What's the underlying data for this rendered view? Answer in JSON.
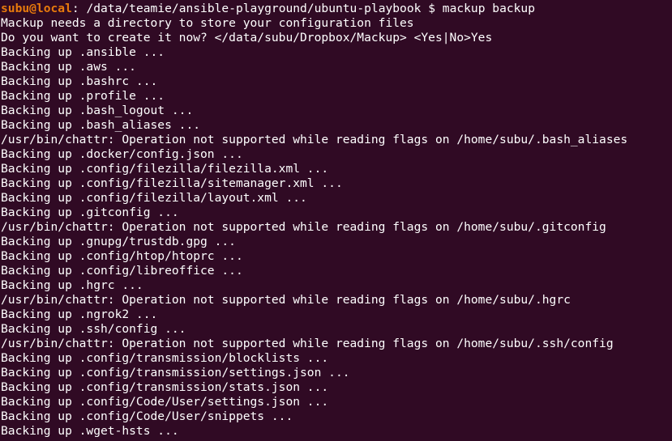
{
  "prompt": {
    "user": "subu",
    "at": "@",
    "host": "local",
    "separator": ": ",
    "path": "/data/teamie/ansible-playground/ubuntu-playbook",
    "symbol": " $ ",
    "command": "mackup backup"
  },
  "output_lines": [
    "Mackup needs a directory to store your configuration files",
    "Do you want to create it now? </data/subu/Dropbox/Mackup> <Yes|No>Yes",
    "Backing up .ansible ...",
    "Backing up .aws ...",
    "Backing up .bashrc ...",
    "Backing up .profile ...",
    "Backing up .bash_logout ...",
    "Backing up .bash_aliases ...",
    "/usr/bin/chattr: Operation not supported while reading flags on /home/subu/.bash_aliases",
    "Backing up .docker/config.json ...",
    "Backing up .config/filezilla/filezilla.xml ...",
    "Backing up .config/filezilla/sitemanager.xml ...",
    "Backing up .config/filezilla/layout.xml ...",
    "Backing up .gitconfig ...",
    "/usr/bin/chattr: Operation not supported while reading flags on /home/subu/.gitconfig",
    "Backing up .gnupg/trustdb.gpg ...",
    "Backing up .config/htop/htoprc ...",
    "Backing up .config/libreoffice ...",
    "Backing up .hgrc ...",
    "/usr/bin/chattr: Operation not supported while reading flags on /home/subu/.hgrc",
    "Backing up .ngrok2 ...",
    "Backing up .ssh/config ...",
    "/usr/bin/chattr: Operation not supported while reading flags on /home/subu/.ssh/config",
    "Backing up .config/transmission/blocklists ...",
    "Backing up .config/transmission/settings.json ...",
    "Backing up .config/transmission/stats.json ...",
    "Backing up .config/Code/User/settings.json ...",
    "Backing up .config/Code/User/snippets ...",
    "Backing up .wget-hsts ..."
  ],
  "colors": {
    "background": "#300a24",
    "prompt_user_host": "#e87a0c",
    "text": "#ffffff"
  }
}
